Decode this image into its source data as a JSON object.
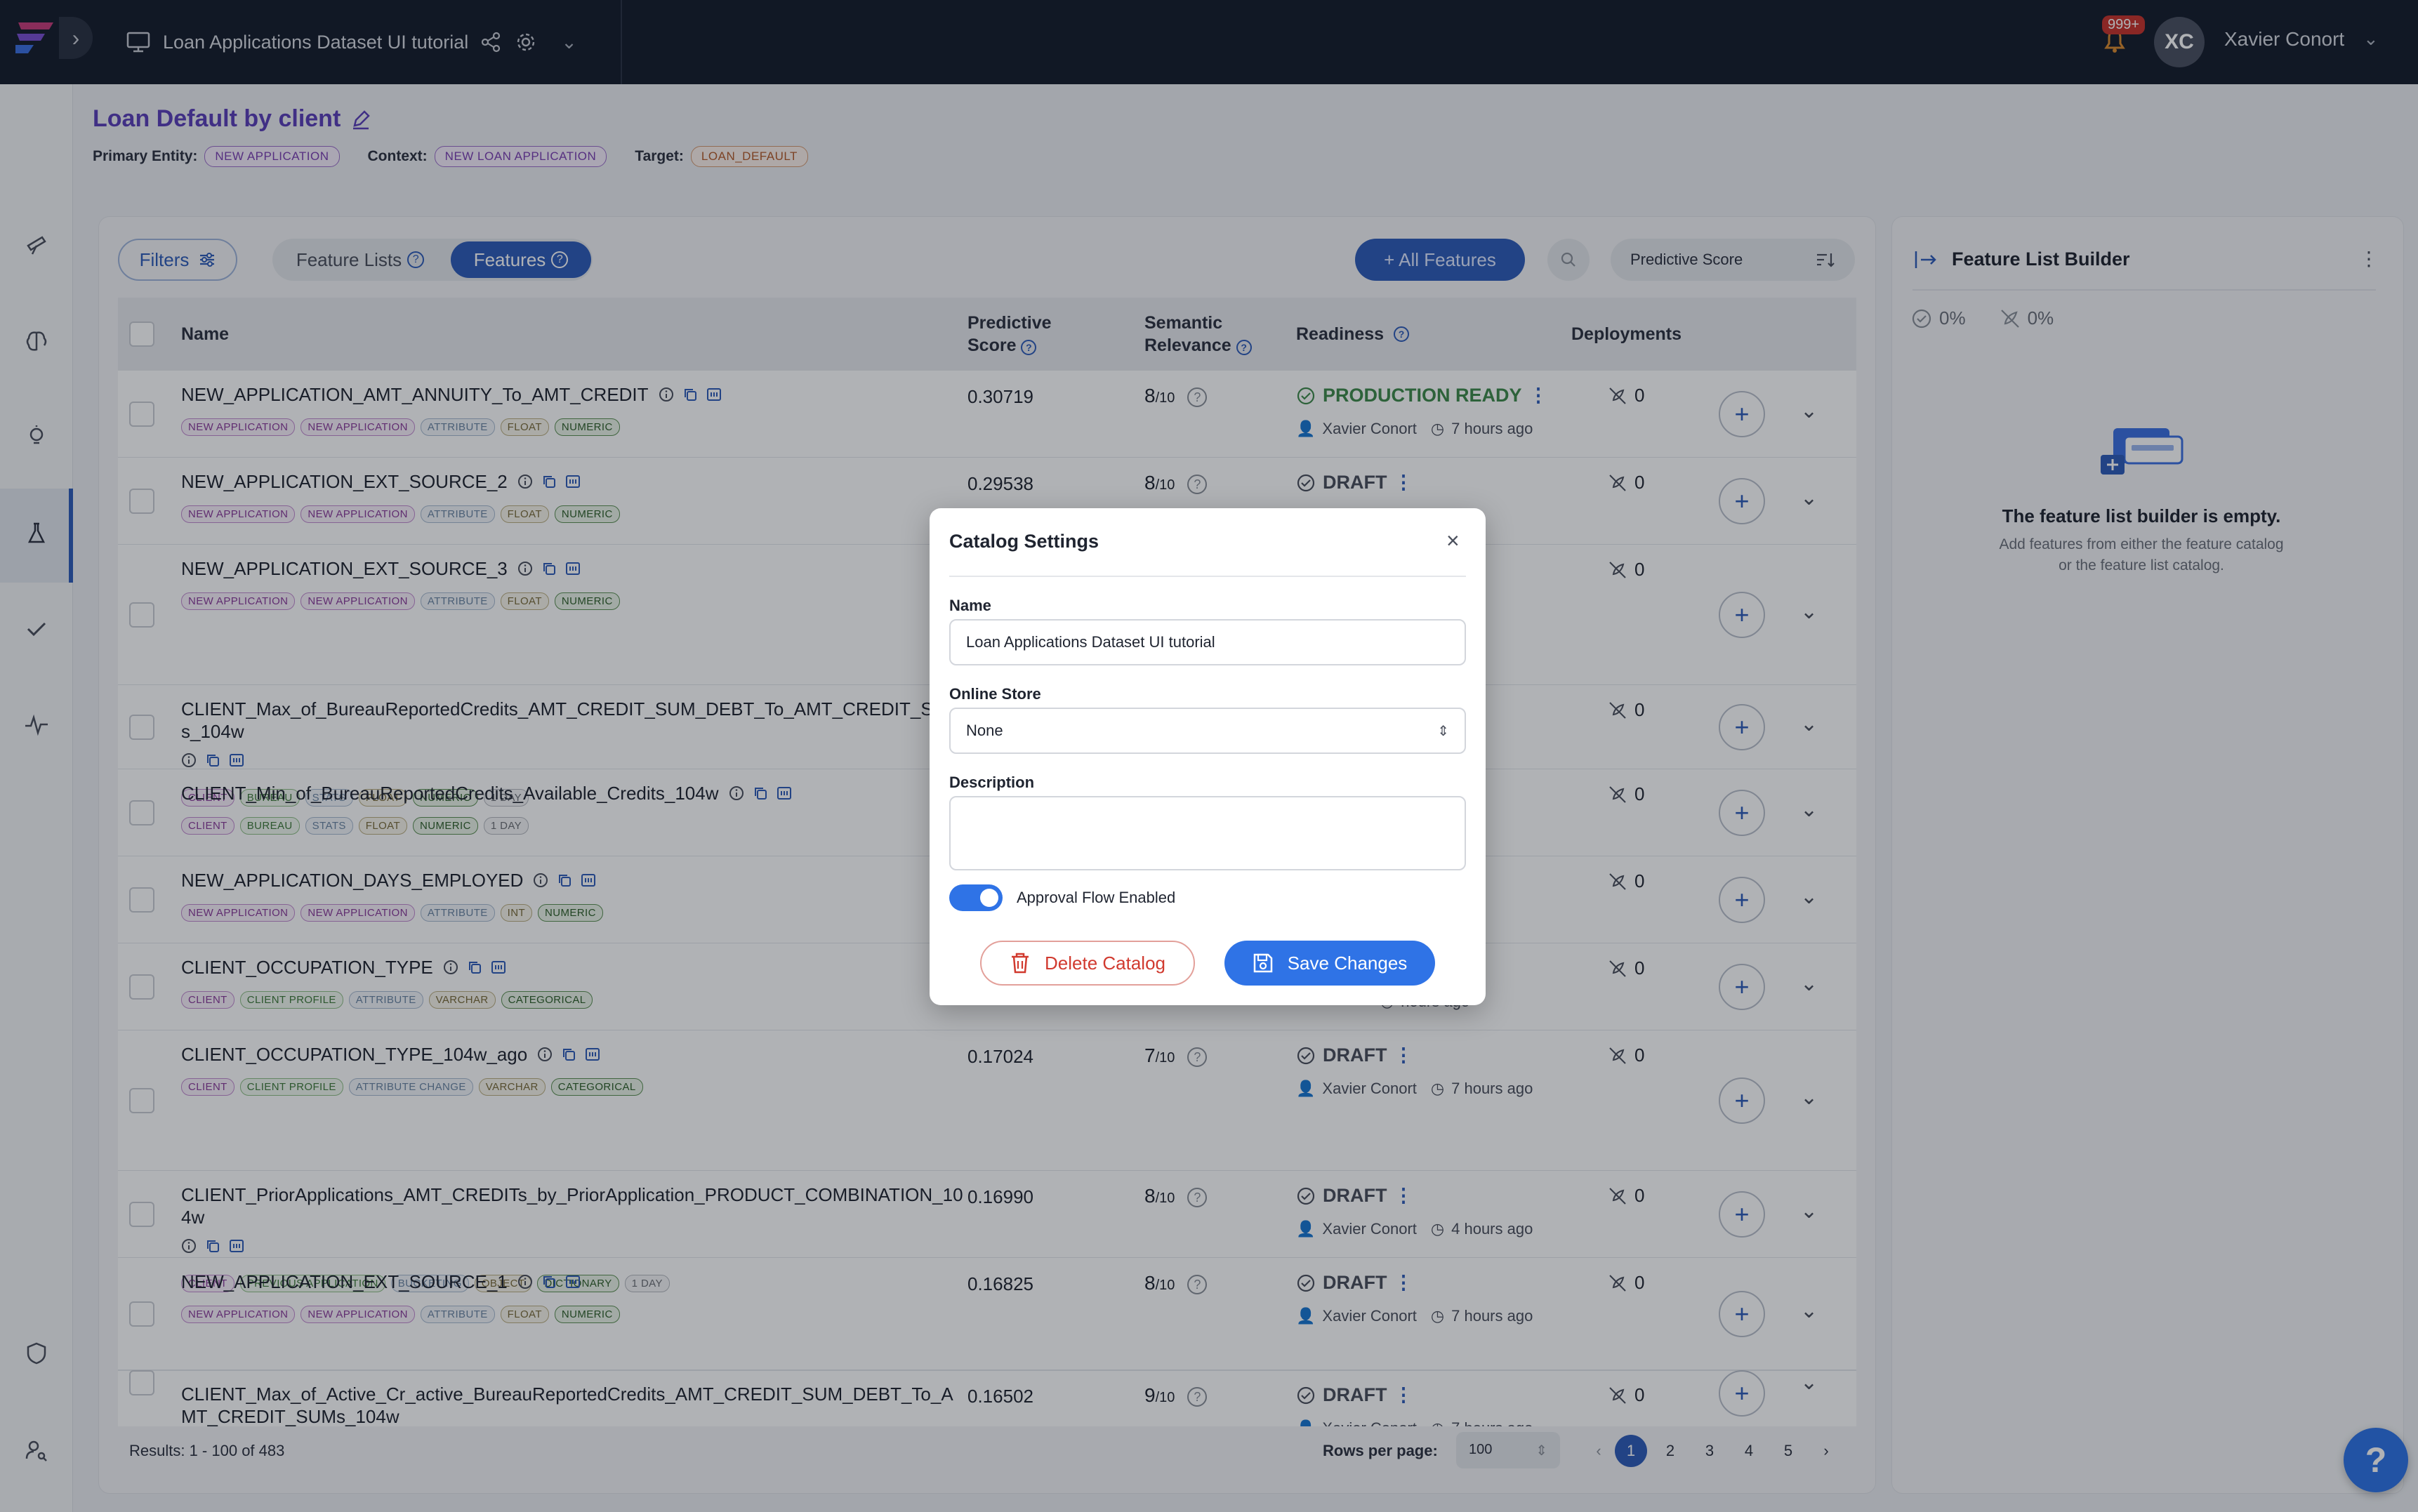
{
  "topbar": {
    "project_name": "Loan Applications Dataset UI tutorial",
    "notification_count": "999+",
    "avatar_initials": "XC",
    "user_name": "Xavier Conort"
  },
  "header": {
    "title": "Loan Default by client",
    "primary_entity_label": "Primary Entity:",
    "primary_entity": "NEW APPLICATION",
    "context_label": "Context:",
    "context": "NEW LOAN APPLICATION",
    "target_label": "Target:",
    "target": "LOAN_DEFAULT"
  },
  "toolbar": {
    "filters": "Filters",
    "tab_feature_lists": "Feature Lists",
    "tab_features": "Features",
    "all_features": "+ All Features",
    "sort_by": "Predictive Score"
  },
  "table": {
    "columns": {
      "name": "Name",
      "score_1": "Predictive",
      "score_2": "Score",
      "relevance_1": "Semantic",
      "relevance_2": "Relevance",
      "readiness": "Readiness",
      "deployments": "Deployments"
    },
    "rows": [
      {
        "name": "NEW_APPLICATION_AMT_ANNUITY_To_AMT_CREDIT",
        "score": "0.30719",
        "rel": "8",
        "readiness": "PRODUCTION READY",
        "owner": "Xavier Conort",
        "age": "7 hours ago",
        "deps": "0",
        "tags": [
          "NEW APPLICATION",
          "NEW APPLICATION",
          "ATTRIBUTE",
          "FLOAT",
          "NUMERIC"
        ]
      },
      {
        "name": "NEW_APPLICATION_EXT_SOURCE_2",
        "score": "0.29538",
        "rel": "8",
        "readiness": "DRAFT",
        "owner": "",
        "age": "urs ago",
        "deps": "0",
        "tags": [
          "NEW APPLICATION",
          "NEW APPLICATION",
          "ATTRIBUTE",
          "FLOAT",
          "NUMERIC"
        ]
      },
      {
        "name": "NEW_APPLICATION_EXT_SOURCE_3",
        "score": "",
        "rel": "",
        "readiness": "",
        "owner": "",
        "age": "urs ago",
        "deps": "0",
        "tags": [
          "NEW APPLICATION",
          "NEW APPLICATION",
          "ATTRIBUTE",
          "FLOAT",
          "NUMERIC"
        ]
      },
      {
        "name": "CLIENT_Max_of_BureauReportedCredits_AMT_CREDIT_SUM_DEBT_To_AMT_CREDIT_SUMs_104w",
        "score": "",
        "rel": "",
        "readiness": "",
        "owner": "",
        "age": "urs ago",
        "deps": "0",
        "tags": [
          "CLIENT",
          "BUREAU",
          "STATS",
          "FLOAT",
          "NUMERIC",
          "1 DAY"
        ]
      },
      {
        "name": "CLIENT_Min_of_BureauReportedCredits_Available_Credits_104w",
        "score": "",
        "rel": "",
        "readiness": "",
        "owner": "",
        "age": "urs ago",
        "deps": "0",
        "tags": [
          "CLIENT",
          "BUREAU",
          "STATS",
          "FLOAT",
          "NUMERIC",
          "1 DAY"
        ]
      },
      {
        "name": "NEW_APPLICATION_DAYS_EMPLOYED",
        "score": "",
        "rel": "",
        "readiness": "",
        "owner": "",
        "age": "urs ago",
        "deps": "0",
        "tags": [
          "NEW APPLICATION",
          "NEW APPLICATION",
          "ATTRIBUTE",
          "INT",
          "NUMERIC"
        ]
      },
      {
        "name": "CLIENT_OCCUPATION_TYPE",
        "score": "",
        "rel": "",
        "readiness": "",
        "owner": "",
        "age": "hours ago",
        "deps": "0",
        "tags": [
          "CLIENT",
          "CLIENT PROFILE",
          "ATTRIBUTE",
          "VARCHAR",
          "CATEGORICAL"
        ]
      },
      {
        "name": "CLIENT_OCCUPATION_TYPE_104w_ago",
        "score": "0.17024",
        "rel": "7",
        "readiness": "DRAFT",
        "owner": "Xavier Conort",
        "age": "7 hours ago",
        "deps": "0",
        "tags": [
          "CLIENT",
          "CLIENT PROFILE",
          "ATTRIBUTE CHANGE",
          "VARCHAR",
          "CATEGORICAL"
        ]
      },
      {
        "name": "CLIENT_PriorApplications_AMT_CREDITs_by_PriorApplication_PRODUCT_COMBINATION_104w",
        "score": "0.16990",
        "rel": "8",
        "readiness": "DRAFT",
        "owner": "Xavier Conort",
        "age": "4 hours ago",
        "deps": "0",
        "tags": [
          "CLIENT",
          "PREVIOUS APPLICATION",
          "BUCKETING",
          "OBJECT",
          "DICTIONARY",
          "1 DAY"
        ]
      },
      {
        "name": "NEW_APPLICATION_EXT_SOURCE_1",
        "score": "0.16825",
        "rel": "8",
        "readiness": "DRAFT",
        "owner": "Xavier Conort",
        "age": "7 hours ago",
        "deps": "0",
        "tags": [
          "NEW APPLICATION",
          "NEW APPLICATION",
          "ATTRIBUTE",
          "FLOAT",
          "NUMERIC"
        ]
      },
      {
        "name": "CLIENT_Max_of_Active_Cr_active_BureauReportedCredits_AMT_CREDIT_SUM_DEBT_To_AMT_CREDIT_SUMs_104w",
        "score": "0.16502",
        "rel": "9",
        "readiness": "DRAFT",
        "owner": "Xavier Conort",
        "age": "7 hours ago",
        "deps": "0",
        "tags": []
      }
    ],
    "rel_denominator": "/10"
  },
  "footer": {
    "results": "Results: 1 - 100 of 483",
    "rows_per_page_label": "Rows per page:",
    "rows_per_page": "100",
    "pages": [
      "1",
      "2",
      "3",
      "4",
      "5"
    ]
  },
  "builder": {
    "title": "Feature List Builder",
    "stat_1": "0%",
    "stat_2": "0%",
    "empty_title": "The feature list builder is empty.",
    "empty_line_1": "Add features from either the feature catalog",
    "empty_line_2": "or the feature list catalog."
  },
  "modal": {
    "title": "Catalog Settings",
    "name_label": "Name",
    "name_value": "Loan Applications Dataset UI tutorial",
    "store_label": "Online Store",
    "store_value": "None",
    "desc_label": "Description",
    "desc_value": "",
    "toggle_label": "Approval Flow Enabled",
    "toggle_on": true,
    "delete": "Delete Catalog",
    "save": "Save Changes"
  },
  "help": "?",
  "colors": {
    "accent": "#2f5cb8",
    "primary": "#2f73e6",
    "danger": "#d13a2f",
    "topbar": "#161c2b",
    "title": "#5b3fb9"
  }
}
